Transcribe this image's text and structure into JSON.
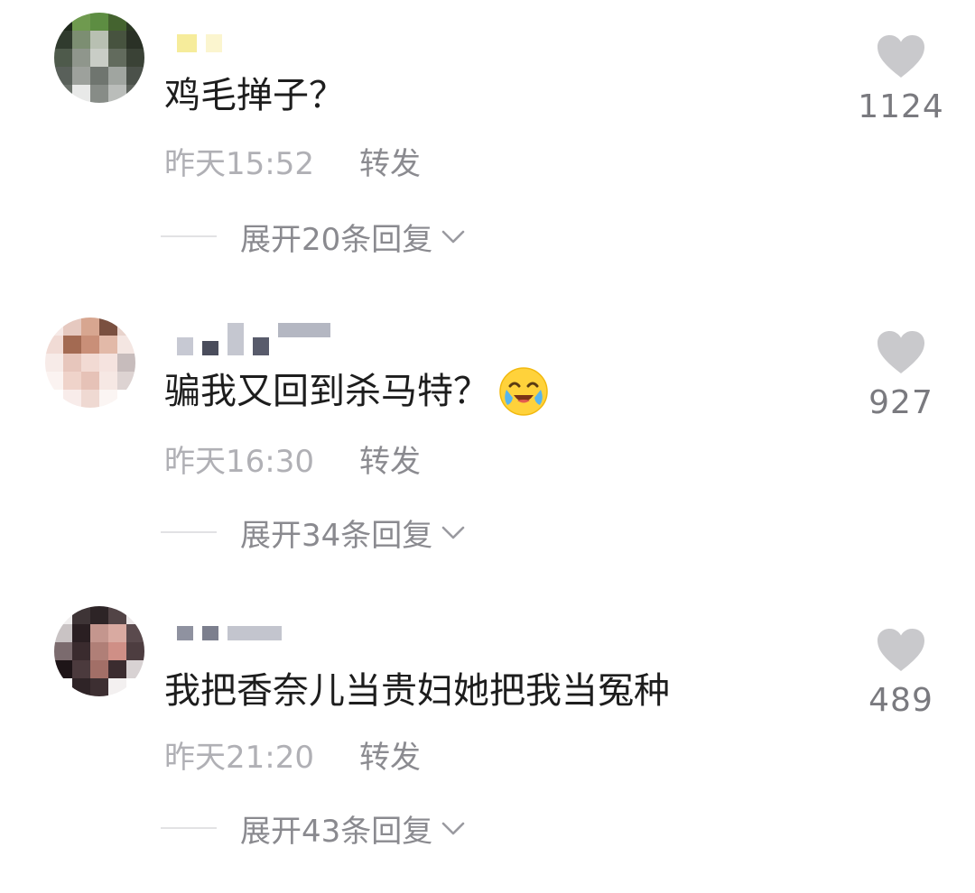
{
  "comments": [
    {
      "text": "鸡毛掸子？",
      "time": "昨天15:52",
      "forward": "转发",
      "expand": "展开20条回复",
      "likes": "1124",
      "emoji_icon": ""
    },
    {
      "text": "骗我又回到杀马特？",
      "time": "昨天16:30",
      "forward": "转发",
      "expand": "展开34条回复",
      "likes": "927",
      "emoji_icon": "crying-laughing-emoji-icon"
    },
    {
      "text": "我把香奈儿当贵妇她把我当冤种",
      "time": "昨天21:20",
      "forward": "转发",
      "expand": "展开43条回复",
      "likes": "489",
      "emoji_icon": ""
    }
  ],
  "colors": {
    "heart": "#c9c9cc",
    "meta_text": "#a8a8ad",
    "expand_text": "#8a8a8f",
    "emoji_yellow": "#ffd23b"
  }
}
